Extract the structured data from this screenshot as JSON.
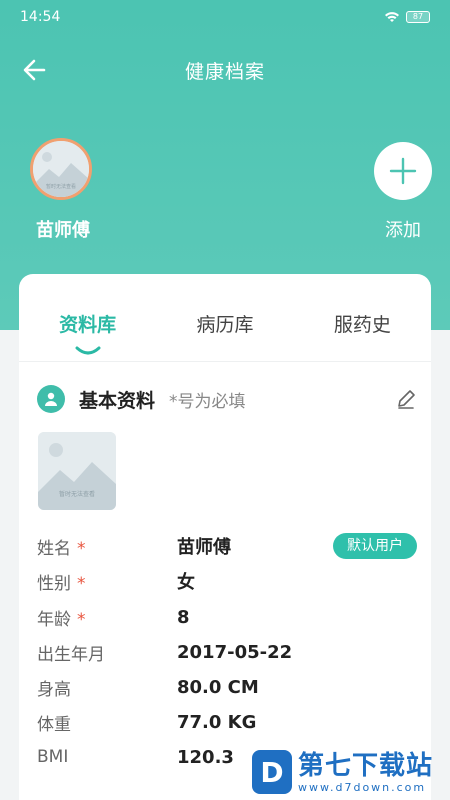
{
  "status_bar": {
    "time": "14:54",
    "battery": "87"
  },
  "header": {
    "title": "健康档案"
  },
  "profiles": {
    "current": {
      "name": "苗师傅",
      "avatar_placeholder": "暂时无法查看"
    },
    "add_label": "添加"
  },
  "tabs": [
    {
      "label": "资料库",
      "active": true
    },
    {
      "label": "病历库",
      "active": false
    },
    {
      "label": "服药史",
      "active": false
    }
  ],
  "basic_info": {
    "title": "基本资料",
    "hint": "*号为必填",
    "photo_placeholder": "暂时无法查看",
    "required_mark": "*",
    "default_badge": "默认用户",
    "fields": [
      {
        "label": "姓名",
        "value": "苗师傅",
        "required": true
      },
      {
        "label": "性别",
        "value": "女",
        "required": true
      },
      {
        "label": "年龄",
        "value": "8",
        "required": true
      },
      {
        "label": "出生年月",
        "value": "2017-05-22",
        "required": false
      },
      {
        "label": "身高",
        "value": "80.0 CM",
        "required": false
      },
      {
        "label": "体重",
        "value": "77.0 KG",
        "required": false
      },
      {
        "label": "BMI",
        "value": "120.3",
        "required": false
      }
    ]
  },
  "watermark": {
    "logo": "D",
    "title": "第七下载站",
    "url": "www.d7down.com"
  },
  "colors": {
    "primary": "#4cc4b2",
    "accent": "#2bb9a5",
    "required": "#e8553f",
    "watermark": "#1f6fc2"
  }
}
